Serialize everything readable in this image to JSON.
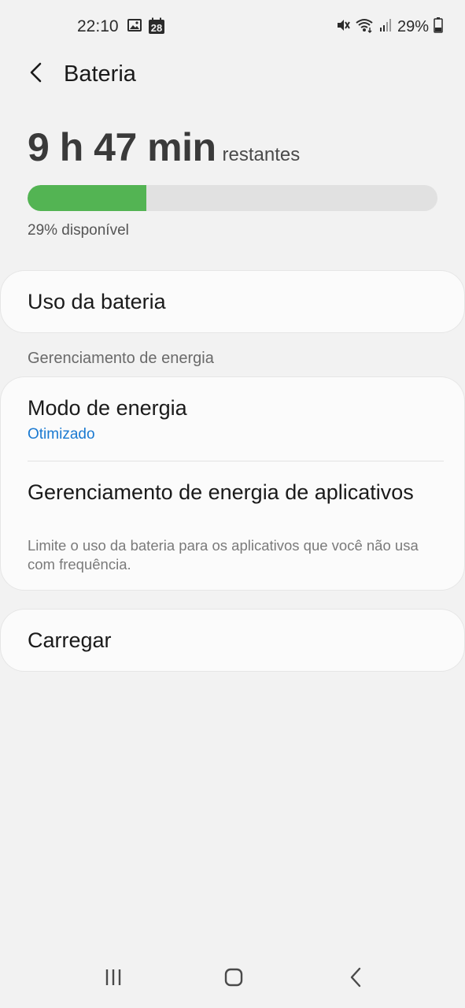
{
  "status_bar": {
    "time": "22:10",
    "calendar_day": "28",
    "battery_percent": "29%",
    "icons": [
      "image-icon",
      "calendar-icon",
      "vibrate-mute-icon",
      "wifi-icon",
      "signal-icon",
      "battery-icon"
    ]
  },
  "header": {
    "title": "Bateria",
    "back_icon": "chevron-left-icon"
  },
  "battery": {
    "time_remaining": "9 h 47 min",
    "suffix": "restantes",
    "level_fraction": 0.29,
    "available_text": "29% disponível",
    "fill_color": "#53b453"
  },
  "usage": {
    "label": "Uso da bateria"
  },
  "power_management": {
    "section_title": "Gerenciamento de energia",
    "mode": {
      "title": "Modo de energia",
      "value": "Otimizado"
    },
    "apps": {
      "title": "Gerenciamento de energia de aplicativos",
      "description": "Limite o uso da bateria para os aplicativos que você não usa com frequência."
    }
  },
  "charging": {
    "label": "Carregar"
  },
  "nav_bar": {
    "icons": [
      "recent-apps-icon",
      "home-icon",
      "back-icon"
    ]
  },
  "colors": {
    "accent": "#1b7ad1",
    "background": "#f2f2f2",
    "card": "#fbfbfb"
  }
}
